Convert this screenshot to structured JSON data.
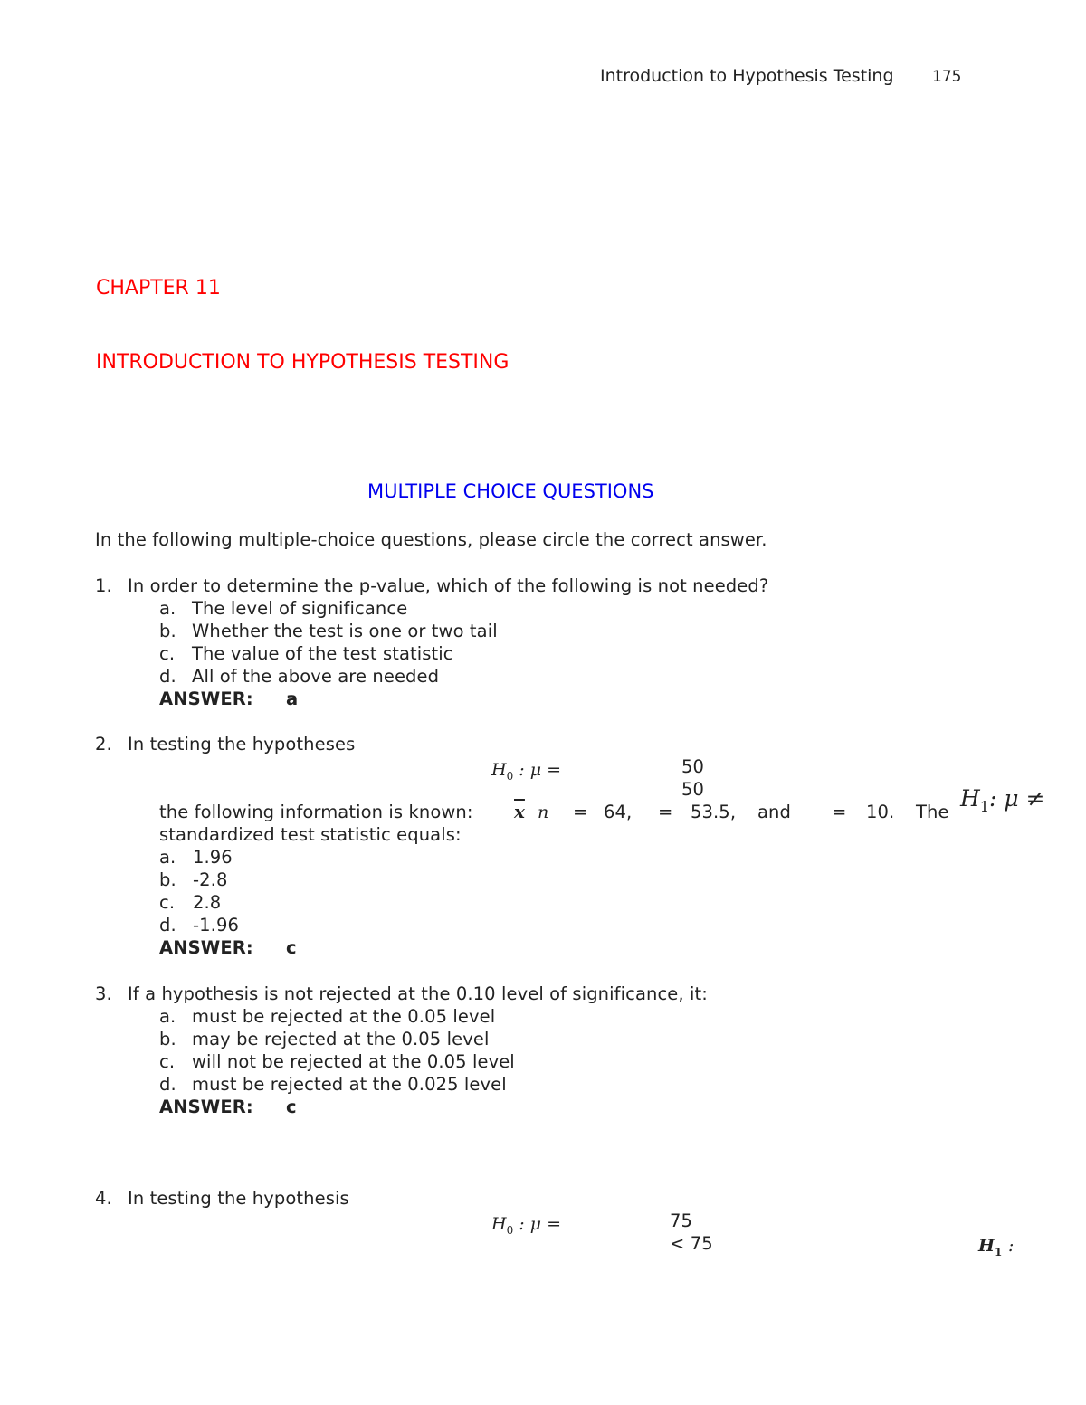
{
  "header": {
    "running_title": "Introduction to Hypothesis Testing",
    "page_number": "175"
  },
  "chapter": {
    "label": "CHAPTER 11",
    "title": "INTRODUCTION TO HYPOTHESIS TESTING"
  },
  "section": {
    "title": "MULTIPLE CHOICE QUESTIONS",
    "instructions": "In the following multiple-choice questions, please circle the correct answer."
  },
  "answer_label": "ANSWER:",
  "questions": [
    {
      "number": "1.",
      "text": "In order to determine the p-value, which of the following is not needed?",
      "options": [
        {
          "letter": "a.",
          "text": "The level of significance"
        },
        {
          "letter": "b.",
          "text": "Whether the test is one or two tail"
        },
        {
          "letter": "c.",
          "text": "The value of the test statistic"
        },
        {
          "letter": "d.",
          "text": "All of the above are needed"
        }
      ],
      "answer": "a"
    },
    {
      "number": "2.",
      "text": "In testing the hypotheses",
      "h0": "H",
      "h0_sub": "0",
      "h0_rel": ": μ =",
      "h0_value": "50",
      "h1_value": "50",
      "h1": "H",
      "h1_sub": "1",
      "h1_rel": ": μ ≠",
      "info_prefix": "the following information is known:",
      "xbar_symbol": "x",
      "n_symbol": "n",
      "eq1": "=",
      "n_value": "64,",
      "eq2": "=",
      "xbar_value": "53.5,",
      "and_word": "and",
      "eq3": "=",
      "sigma_value": "10.",
      "the_word": "The",
      "continuation": "standardized test statistic equals:",
      "options": [
        {
          "letter": "a.",
          "text": "1.96"
        },
        {
          "letter": "b.",
          "text": "-2.8"
        },
        {
          "letter": "c.",
          "text": "2.8"
        },
        {
          "letter": "d.",
          "text": "-1.96"
        }
      ],
      "answer": "c"
    },
    {
      "number": "3.",
      "text": "If a hypothesis is not rejected at the 0.10 level of significance, it:",
      "options": [
        {
          "letter": "a.",
          "text": "must be rejected at the 0.05 level"
        },
        {
          "letter": "b.",
          "text": "may be rejected at the 0.05 level"
        },
        {
          "letter": "c.",
          "text": "will not be rejected at the 0.05 level"
        },
        {
          "letter": "d.",
          "text": "must be rejected at the 0.025 level"
        }
      ],
      "answer": "c"
    },
    {
      "number": "4.",
      "text": "In testing the hypothesis",
      "h0": "H",
      "h0_sub": "0",
      "h0_rel": ": μ =",
      "h0_value": "75",
      "h1_value": "< 75",
      "h1": "H",
      "h1_sub": "1",
      "h1_rel": ":"
    }
  ],
  "colors": {
    "chapter_red": "#ff0000",
    "section_blue": "#0000ee",
    "text": "#222222"
  }
}
